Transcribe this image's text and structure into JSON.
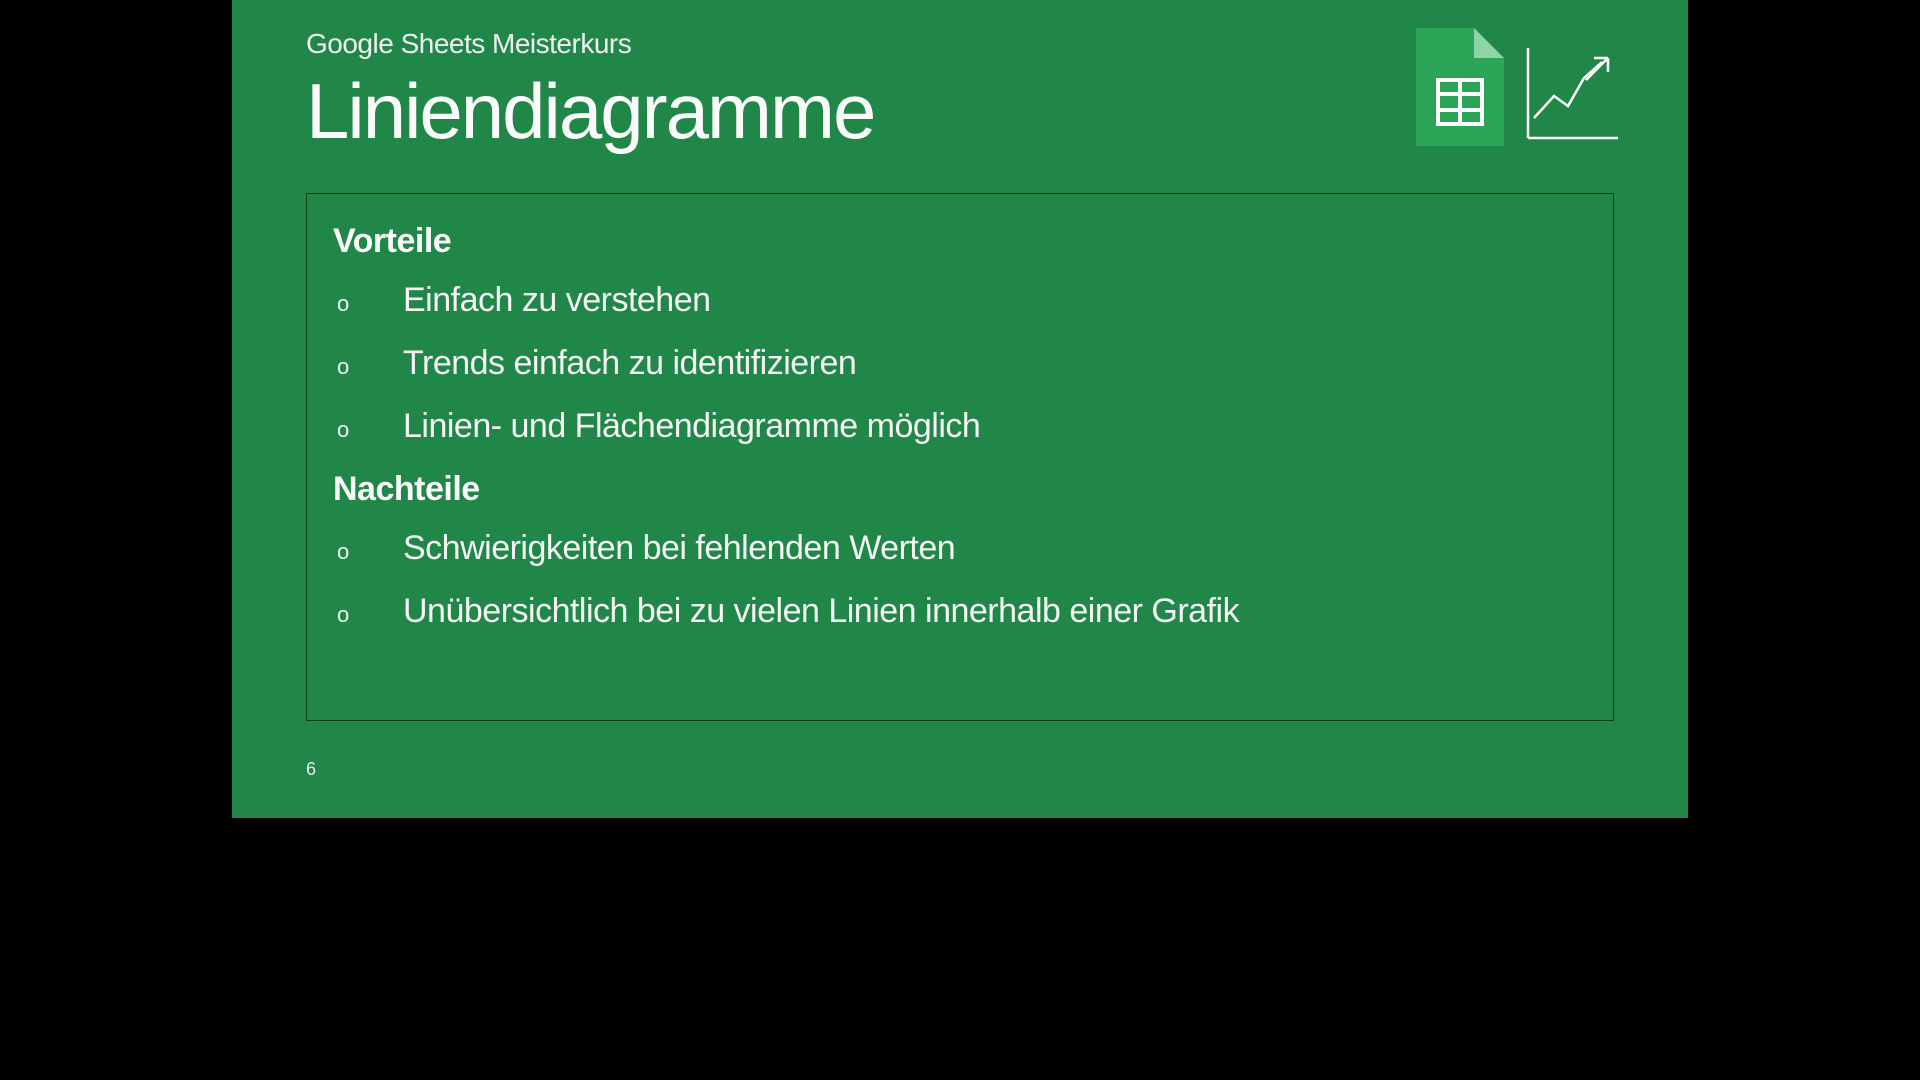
{
  "header": {
    "subtitle": "Google Sheets Meisterkurs",
    "title": "Liniendiagramme"
  },
  "content": {
    "section1_heading": "Vorteile",
    "section1_items": [
      "Einfach zu verstehen",
      "Trends einfach zu identifizieren",
      "Linien- und Flächendiagramme möglich"
    ],
    "section2_heading": "Nachteile",
    "section2_items": [
      "Schwierigkeiten bei fehlenden Werten",
      "Unübersichtlich bei zu vielen Linien innerhalb einer Grafik"
    ]
  },
  "bullet_marker": "o",
  "page_number": "6",
  "icons": {
    "sheets": "google-sheets-icon",
    "chart": "line-chart-icon"
  }
}
